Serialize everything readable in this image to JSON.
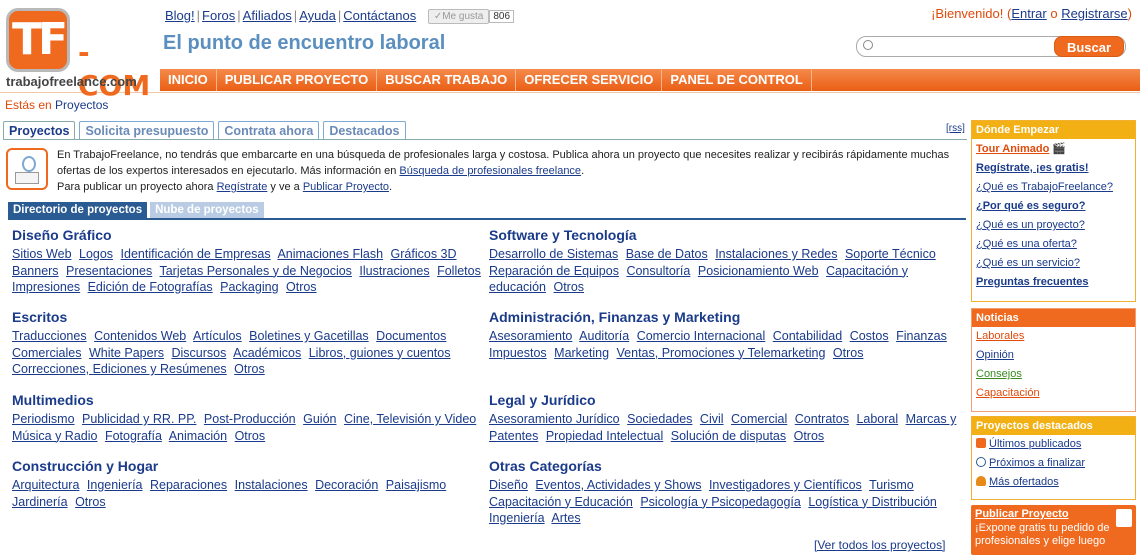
{
  "logo": {
    "mark": "TF",
    "suffix": "-COM",
    "url": "trabajofreelance.com"
  },
  "toplinks": [
    "Blog!",
    "Foros",
    "Afiliados",
    "Ayuda",
    "Contáctanos"
  ],
  "like": {
    "label": "✓Me gusta",
    "count": "806"
  },
  "slogan": "El punto de encuentro laboral",
  "welcome": {
    "greeting": "¡Bienvenido!",
    "open": " (",
    "login": "Entrar",
    "or": " o ",
    "register": "Registrarse",
    "close": ")"
  },
  "search": {
    "placeholder": "",
    "button": "Buscar"
  },
  "nav": [
    "INICIO",
    "PUBLICAR PROYECTO",
    "BUSCAR TRABAJO",
    "OFRECER SERVICIO",
    "PANEL DE CONTROL"
  ],
  "breadcrumb": {
    "prefix": "Estás en",
    "current": "Proyectos"
  },
  "tabs": [
    "Proyectos",
    "Solicita presupuesto",
    "Contrata ahora",
    "Destacados"
  ],
  "rss": "[rss]",
  "intro": {
    "line1": "En TrabajoFreelance, no tendrás que embarcarte en una búsqueda de profesionales larga y costosa. Publica ahora un proyecto que necesites realizar y recibirás rápidamente muchas ofertas de los expertos interesados en ejecutarlo. Más información en ",
    "link1": "Búsqueda de profesionales freelance",
    "end1": ".",
    "line2": "Para publicar un proyecto ahora ",
    "link2": "Regístrate",
    "mid2": " y ve a ",
    "link3": "Publicar Proyecto",
    "end2": "."
  },
  "dir_tabs": [
    "Directorio de proyectos",
    "Nube de proyectos"
  ],
  "categories": [
    {
      "title": "Diseño Gráfico",
      "subs": [
        "Sitios Web",
        "Logos",
        "Identificación de Empresas",
        "Animaciones Flash",
        "Gráficos 3D",
        "Banners",
        "Presentaciones",
        "Tarjetas Personales y de Negocios",
        "Ilustraciones",
        "Folletos",
        "Impresiones",
        "Edición de Fotografías",
        "Packaging",
        "Otros"
      ]
    },
    {
      "title": "Software y Tecnología",
      "subs": [
        "Desarrollo de Sistemas",
        "Base de Datos",
        "Instalaciones y Redes",
        "Soporte Técnico",
        "Reparación de Equipos",
        "Consultoría",
        "Posicionamiento Web",
        "Capacitación y educación",
        "Otros"
      ]
    },
    {
      "title": "Escritos",
      "subs": [
        "Traducciones",
        "Contenidos Web",
        "Artículos",
        "Boletines y Gacetillas",
        "Documentos Comerciales",
        "White Papers",
        "Discursos",
        "Académicos",
        "Libros, guiones y cuentos",
        "Correcciones, Ediciones y Resúmenes",
        "Otros"
      ]
    },
    {
      "title": "Administración, Finanzas y Marketing",
      "subs": [
        "Asesoramiento",
        "Auditoría",
        "Comercio Internacional",
        "Contabilidad",
        "Costos",
        "Finanzas",
        "Impuestos",
        "Marketing",
        "Ventas, Promociones y Telemarketing",
        "Otros"
      ]
    },
    {
      "title": "Multimedios",
      "subs": [
        "Periodismo",
        "Publicidad y RR. PP.",
        "Post-Producción",
        "Guión",
        "Cine, Televisión y Video",
        "Música y Radio",
        "Fotografía",
        "Animación",
        "Otros"
      ]
    },
    {
      "title": "Legal y Jurídico",
      "subs": [
        "Asesoramiento Jurídico",
        "Sociedades",
        "Civil",
        "Comercial",
        "Contratos",
        "Laboral",
        "Marcas y Patentes",
        "Propiedad Intelectual",
        "Solución de disputas",
        "Otros"
      ]
    },
    {
      "title": "Construcción y Hogar",
      "subs": [
        "Arquitectura",
        "Ingeniería",
        "Reparaciones",
        "Instalaciones",
        "Decoración",
        "Paisajismo",
        "Jardinería",
        "Otros"
      ]
    },
    {
      "title": "Otras Categorías",
      "subs": [
        "Diseño",
        "Eventos, Actividades y Shows",
        "Investigadores y Científicos",
        "Turismo",
        "Capacitación y Educación",
        "Psicología y Psicopedagogía",
        "Logística y Distribución",
        "Ingeniería",
        "Artes"
      ]
    }
  ],
  "see_all": "[Ver todos los proyectos]",
  "sidebar": {
    "start": {
      "title": "Dónde Empezar",
      "items": [
        "Tour Animado",
        "Regístrate, ¡es gratis!",
        "¿Qué es TrabajoFreelance?",
        "¿Por qué es seguro?",
        "¿Qué es un proyecto?",
        "¿Qué es una oferta?",
        "¿Qué es un servicio?",
        "Preguntas frecuentes"
      ]
    },
    "news": {
      "title": "Noticias",
      "items": [
        "Laborales",
        "Opinión",
        "Consejos",
        "Capacitación"
      ]
    },
    "featured": {
      "title": "Proyectos destacados",
      "items": [
        "Últimos publicados",
        "Próximos a finalizar",
        "Más ofertados"
      ]
    },
    "publish": {
      "title": "Publicar Proyecto",
      "text": "¡Expone gratis tu pedido de profesionales y elige luego"
    }
  },
  "colors": {
    "accent": "#ef6a1f",
    "link": "#1a3a8a",
    "sidebar_header": "#f2b015"
  }
}
